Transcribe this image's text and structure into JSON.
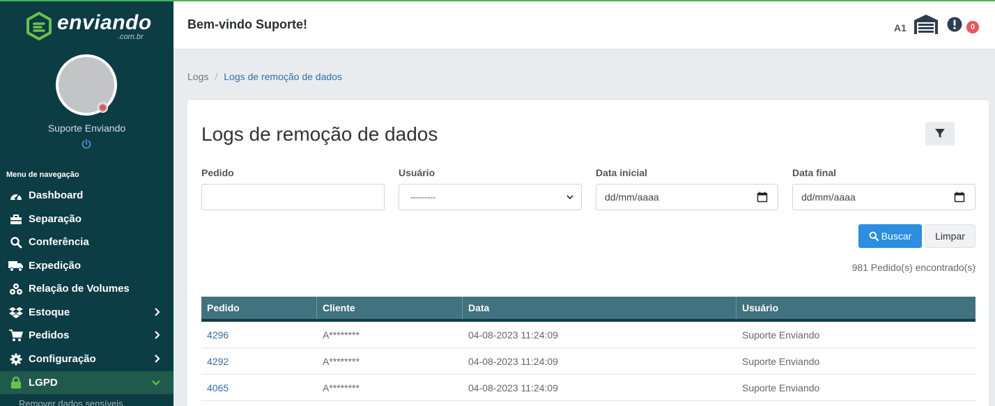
{
  "brand": {
    "name": "enviando",
    "suffix": ".com.br"
  },
  "sidebar": {
    "user_name": "Suporte Enviando",
    "menu_header": "Menu de navegação",
    "items": [
      {
        "label": "Dashboard",
        "icon": "gauge-icon"
      },
      {
        "label": "Separação",
        "icon": "toolbox-icon"
      },
      {
        "label": "Conferência",
        "icon": "search-icon"
      },
      {
        "label": "Expedição",
        "icon": "truck-icon"
      },
      {
        "label": "Relação de Volumes",
        "icon": "boxes-icon"
      },
      {
        "label": "Estoque",
        "icon": "dropbox-icon"
      },
      {
        "label": "Pedidos",
        "icon": "cart-icon"
      },
      {
        "label": "Configuração",
        "icon": "gear-icon"
      },
      {
        "label": "LGPD",
        "icon": "lock-icon"
      }
    ],
    "sub_item": "Remover dados sensíveis"
  },
  "header": {
    "welcome": "Bem-vindo Suporte!",
    "warehouse_code": "A1",
    "alert_count": "0"
  },
  "breadcrumb": {
    "parent": "Logs",
    "current": "Logs de remoção de dados"
  },
  "page": {
    "title": "Logs de remoção de dados",
    "filters": {
      "pedido_label": "Pedido",
      "pedido_value": "",
      "usuario_label": "Usuário",
      "usuario_selected": "---------",
      "data_inicial_label": "Data inicial",
      "data_inicial_value": "dd/mm/aaaa",
      "data_final_label": "Data final",
      "data_final_value": "dd/mm/aaaa"
    },
    "buscar_label": "Buscar",
    "limpar_label": "Limpar",
    "result_count": "981 Pedido(s) encontrado(s)"
  },
  "table": {
    "columns": [
      "Pedido",
      "Cliente",
      "Data",
      "Usuário"
    ],
    "rows": [
      [
        "4296",
        "A********",
        "04-08-2023 11:24:09",
        "Suporte Enviando"
      ],
      [
        "4292",
        "A********",
        "04-08-2023 11:24:09",
        "Suporte Enviando"
      ],
      [
        "4065",
        "A********",
        "04-08-2023 11:24:09",
        "Suporte Enviando"
      ]
    ]
  },
  "colors": {
    "sidebar": "#0c3c44",
    "accent": "#2b8ee0",
    "table_header": "#40727f",
    "active_nav": "#1f5a4d",
    "brand_green": "#6cc04a"
  }
}
